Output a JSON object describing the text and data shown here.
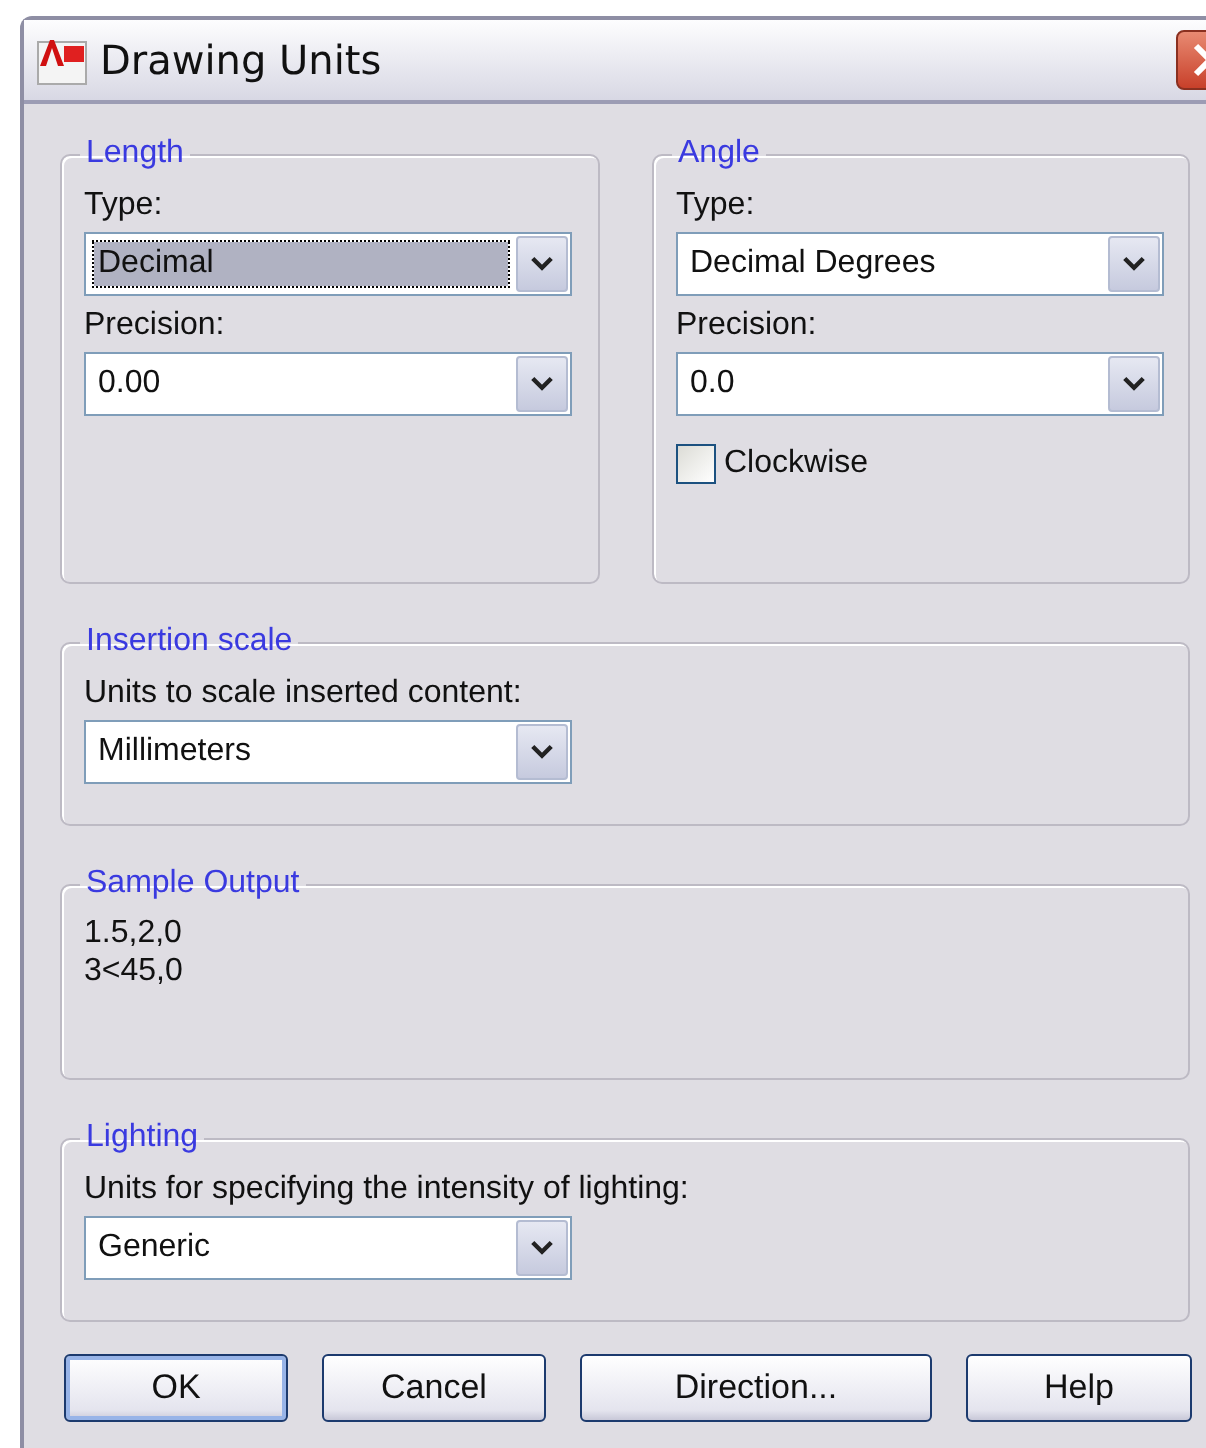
{
  "window": {
    "title": "Drawing Units"
  },
  "length": {
    "title": "Length",
    "fields": [
      {
        "label": "Type:",
        "value": "Decimal",
        "focused": true
      },
      {
        "label": "Precision:",
        "value": "0.00",
        "focused": false
      }
    ]
  },
  "angle": {
    "title": "Angle",
    "fields": [
      {
        "label": "Type:",
        "value": "Decimal Degrees",
        "focused": false
      },
      {
        "label": "Precision:",
        "value": "0.0",
        "focused": false
      }
    ],
    "clockwise": {
      "label": "Clockwise",
      "checked": false
    }
  },
  "insertion_scale": {
    "title": "Insertion scale",
    "fields": [
      {
        "label": "Units to scale inserted content:",
        "value": "Millimeters",
        "focused": false
      }
    ]
  },
  "sample_output": {
    "title": "Sample Output",
    "lines": [
      "1.5,2,0",
      "3<45,0"
    ]
  },
  "lighting": {
    "title": "Lighting",
    "fields": [
      {
        "label": "Units for specifying the intensity of lighting:",
        "value": "Generic",
        "focused": false
      }
    ]
  },
  "buttons": [
    {
      "label": "OK",
      "default": true
    },
    {
      "label": "Cancel",
      "default": false
    },
    {
      "label": "Direction...",
      "default": false
    },
    {
      "label": "Help",
      "default": false
    }
  ]
}
